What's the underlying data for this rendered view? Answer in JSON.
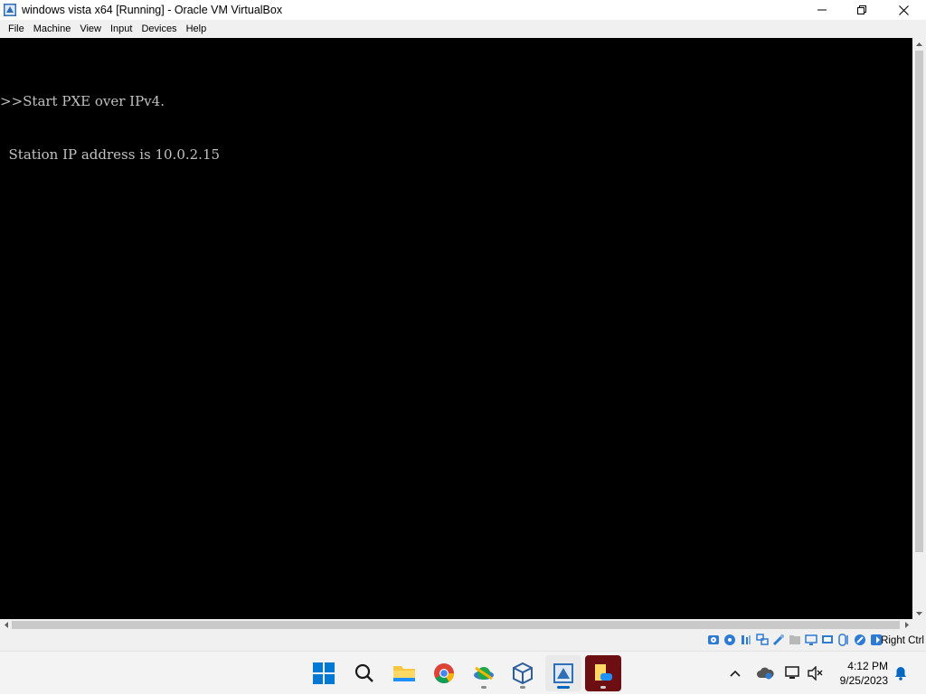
{
  "window": {
    "title": "windows vista x64 [Running] - Oracle VM VirtualBox",
    "icon": "virtualbox-icon"
  },
  "menu": [
    "File",
    "Machine",
    "View",
    "Input",
    "Devices",
    "Help"
  ],
  "console": {
    "lines": [
      ">>Start PXE over IPv4.",
      "  Station IP address is 10.0.2.15"
    ]
  },
  "statusbar": {
    "icons": [
      "hard-disk-icon",
      "optical-disk-icon",
      "audio-icon",
      "network-icon",
      "usb-icon",
      "shared-folders-icon",
      "display-icon",
      "video-capture-icon",
      "mouse-integration-icon",
      "cpu-icon",
      "arrow-icon"
    ],
    "host_key": "Right Ctrl"
  },
  "taskbar": {
    "apps": [
      "start-icon",
      "search-icon",
      "file-explorer-icon",
      "chrome-icon",
      "satellite-app-icon",
      "virtualbox-icon",
      "vm-window-icon",
      "notes-app-icon"
    ],
    "time": "4:12 PM",
    "date": "9/25/2023",
    "accent": "#0067c0"
  }
}
